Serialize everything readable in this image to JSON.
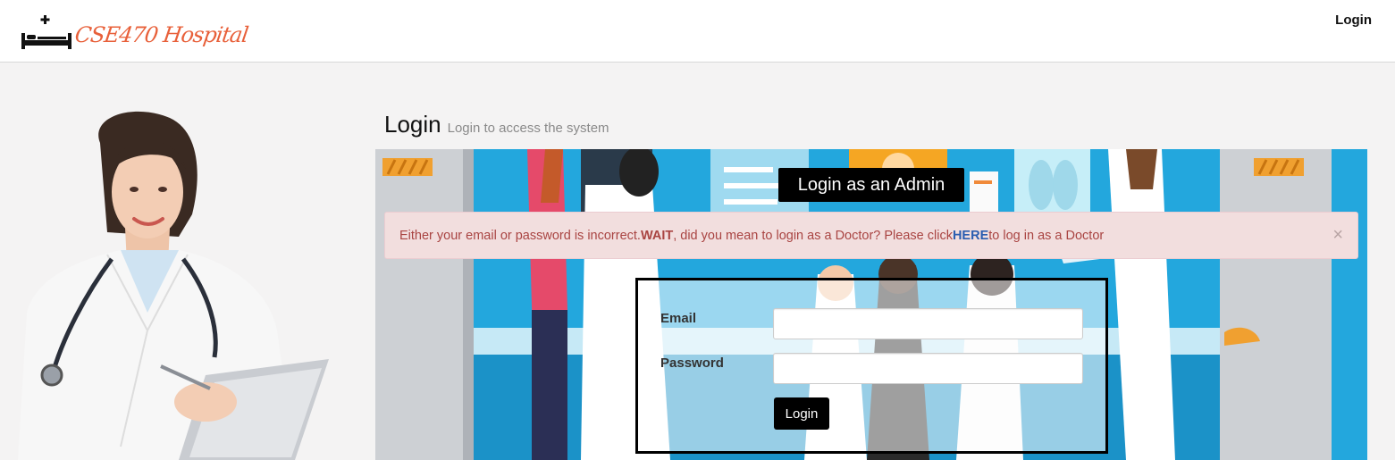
{
  "navbar": {
    "brand_text": "CSE470 Hospital",
    "login_link": "Login"
  },
  "page": {
    "title": "Login",
    "subtitle": "Login to access the system"
  },
  "banner": {
    "admin_label": "Login as an Admin"
  },
  "alert": {
    "text_before": "Either your email or password is incorrect. ",
    "strong": "WAIT",
    "text_middle": ", did you mean to login as a Doctor? Please click ",
    "link": "HERE",
    "text_after": " to log in as a Doctor",
    "close": "×"
  },
  "form": {
    "email_label": "Email",
    "email_value": "",
    "password_label": "Password",
    "password_value": "",
    "submit_label": "Login"
  },
  "colors": {
    "brand": "#e8603a",
    "alert_bg": "#f2dede",
    "alert_text": "#a94442",
    "link": "#2a5db0"
  }
}
